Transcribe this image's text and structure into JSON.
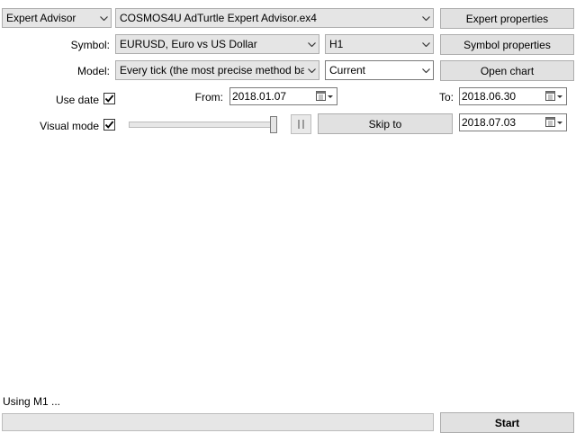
{
  "tester": {
    "type_select": "Expert Advisor",
    "expert_select": "COSMOS4U AdTurtle Expert Advisor.ex4",
    "expert_properties_btn": "Expert properties",
    "symbol_label": "Symbol:",
    "symbol_select": "EURUSD, Euro vs US Dollar",
    "period_select": "H1",
    "symbol_properties_btn": "Symbol properties",
    "model_label": "Model:",
    "model_select": "Every tick (the most precise method based",
    "spread_select": "Current",
    "open_chart_btn": "Open chart",
    "use_date_label": "Use date",
    "use_date_checked": true,
    "from_label": "From:",
    "from_date": "2018.01.07",
    "to_label": "To:",
    "to_date": "2018.06.30",
    "visual_mode_label": "Visual mode",
    "visual_mode_checked": true,
    "skip_to_btn": "Skip to",
    "skip_to_date": "2018.07.03",
    "speed_level": 1.0
  },
  "status": {
    "text": "Using M1 ...",
    "start_btn": "Start"
  }
}
